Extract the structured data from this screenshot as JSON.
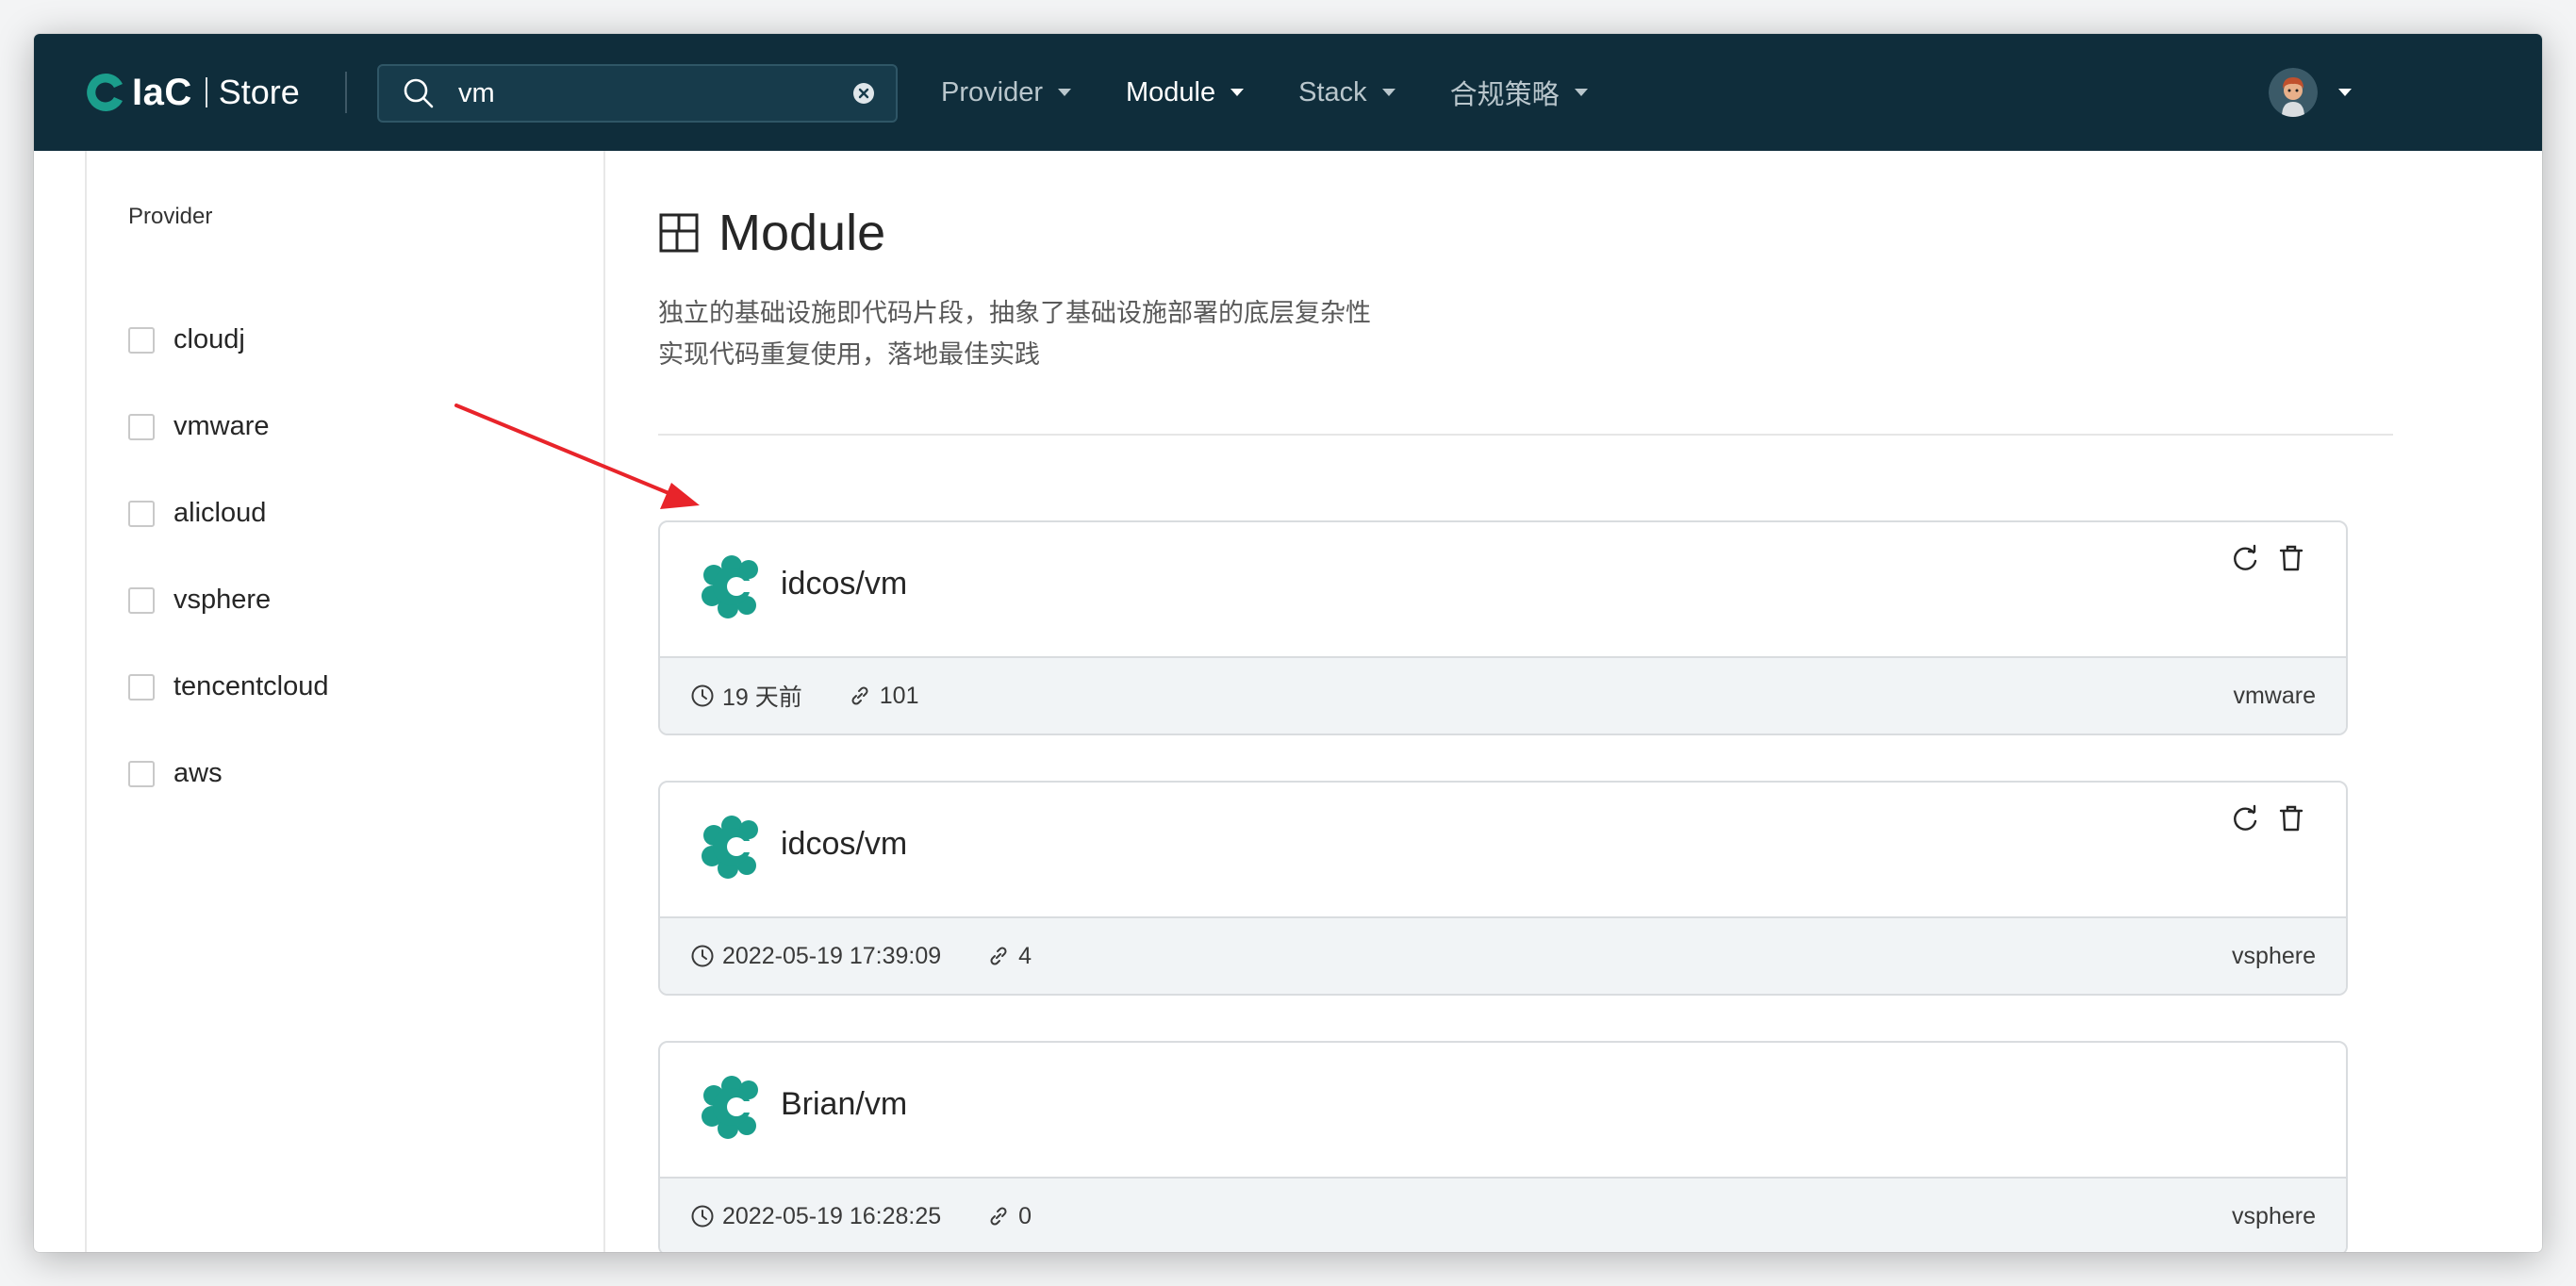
{
  "header": {
    "logo_text": "IaC",
    "logo_store": "Store",
    "search": {
      "value": "vm"
    },
    "nav": [
      {
        "label": "Provider",
        "active": false
      },
      {
        "label": "Module",
        "active": true
      },
      {
        "label": "Stack",
        "active": false
      },
      {
        "label": "合规策略",
        "active": false
      }
    ]
  },
  "sidebar": {
    "title": "Provider",
    "filters": [
      "cloudj",
      "vmware",
      "alicloud",
      "vsphere",
      "tencentcloud",
      "aws"
    ]
  },
  "main": {
    "title": "Module",
    "description_line1": "独立的基础设施即代码片段，抽象了基础设施部署的底层复杂性",
    "description_line2": "实现代码重复使用，落地最佳实践",
    "cards": [
      {
        "name": "idcos/vm",
        "time": "19 天前",
        "links": "101",
        "provider": "vmware",
        "has_actions": true
      },
      {
        "name": "idcos/vm",
        "time": "2022-05-19 17:39:09",
        "links": "4",
        "provider": "vsphere",
        "has_actions": true
      },
      {
        "name": "Brian/vm",
        "time": "2022-05-19 16:28:25",
        "links": "0",
        "provider": "vsphere",
        "has_actions": false
      }
    ]
  },
  "colors": {
    "header_bg": "#0f2d3b",
    "brand_teal": "#1b9e8c",
    "annotation_arrow": "#e8242a"
  }
}
